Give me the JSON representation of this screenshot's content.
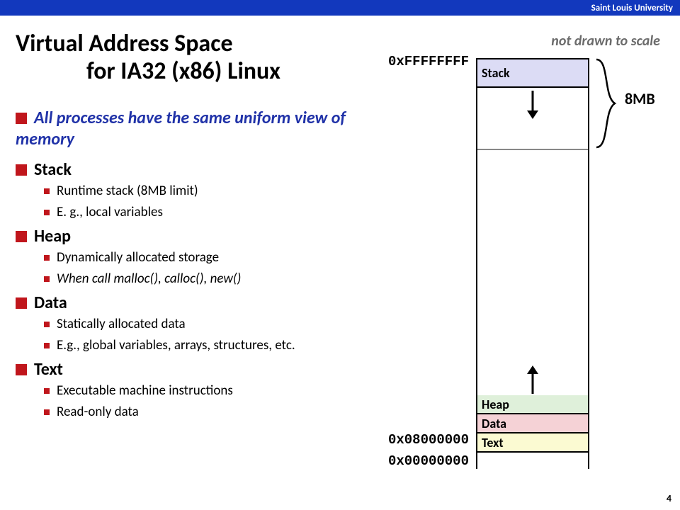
{
  "header": {
    "org": "Saint Louis University"
  },
  "title": {
    "line1": "Virtual Address Space",
    "line2": "for IA32 (x86) Linux"
  },
  "note": "not drawn to scale",
  "bullets": {
    "intro": "All processes have the same uniform view of memory",
    "stack": {
      "label": "Stack",
      "items": [
        "Runtime stack (8MB limit)",
        "E. g., local variables"
      ]
    },
    "heap": {
      "label": "Heap",
      "items": [
        "Dynamically allocated storage",
        "When call  malloc(), calloc(), new()"
      ]
    },
    "data": {
      "label": "Data",
      "items": [
        "Statically allocated data",
        "E.g., global variables, arrays, structures, etc."
      ]
    },
    "text": {
      "label": "Text",
      "items": [
        "Executable machine instructions",
        "Read-only data"
      ]
    }
  },
  "diagram": {
    "stack": "Stack",
    "heap": "Heap",
    "data": "Data",
    "text": "Text",
    "addr_top": "0xFFFFFFFF",
    "addr_mid": "0x08000000",
    "addr_low": "0x00000000",
    "brace_label": "8MB"
  },
  "page": "4"
}
